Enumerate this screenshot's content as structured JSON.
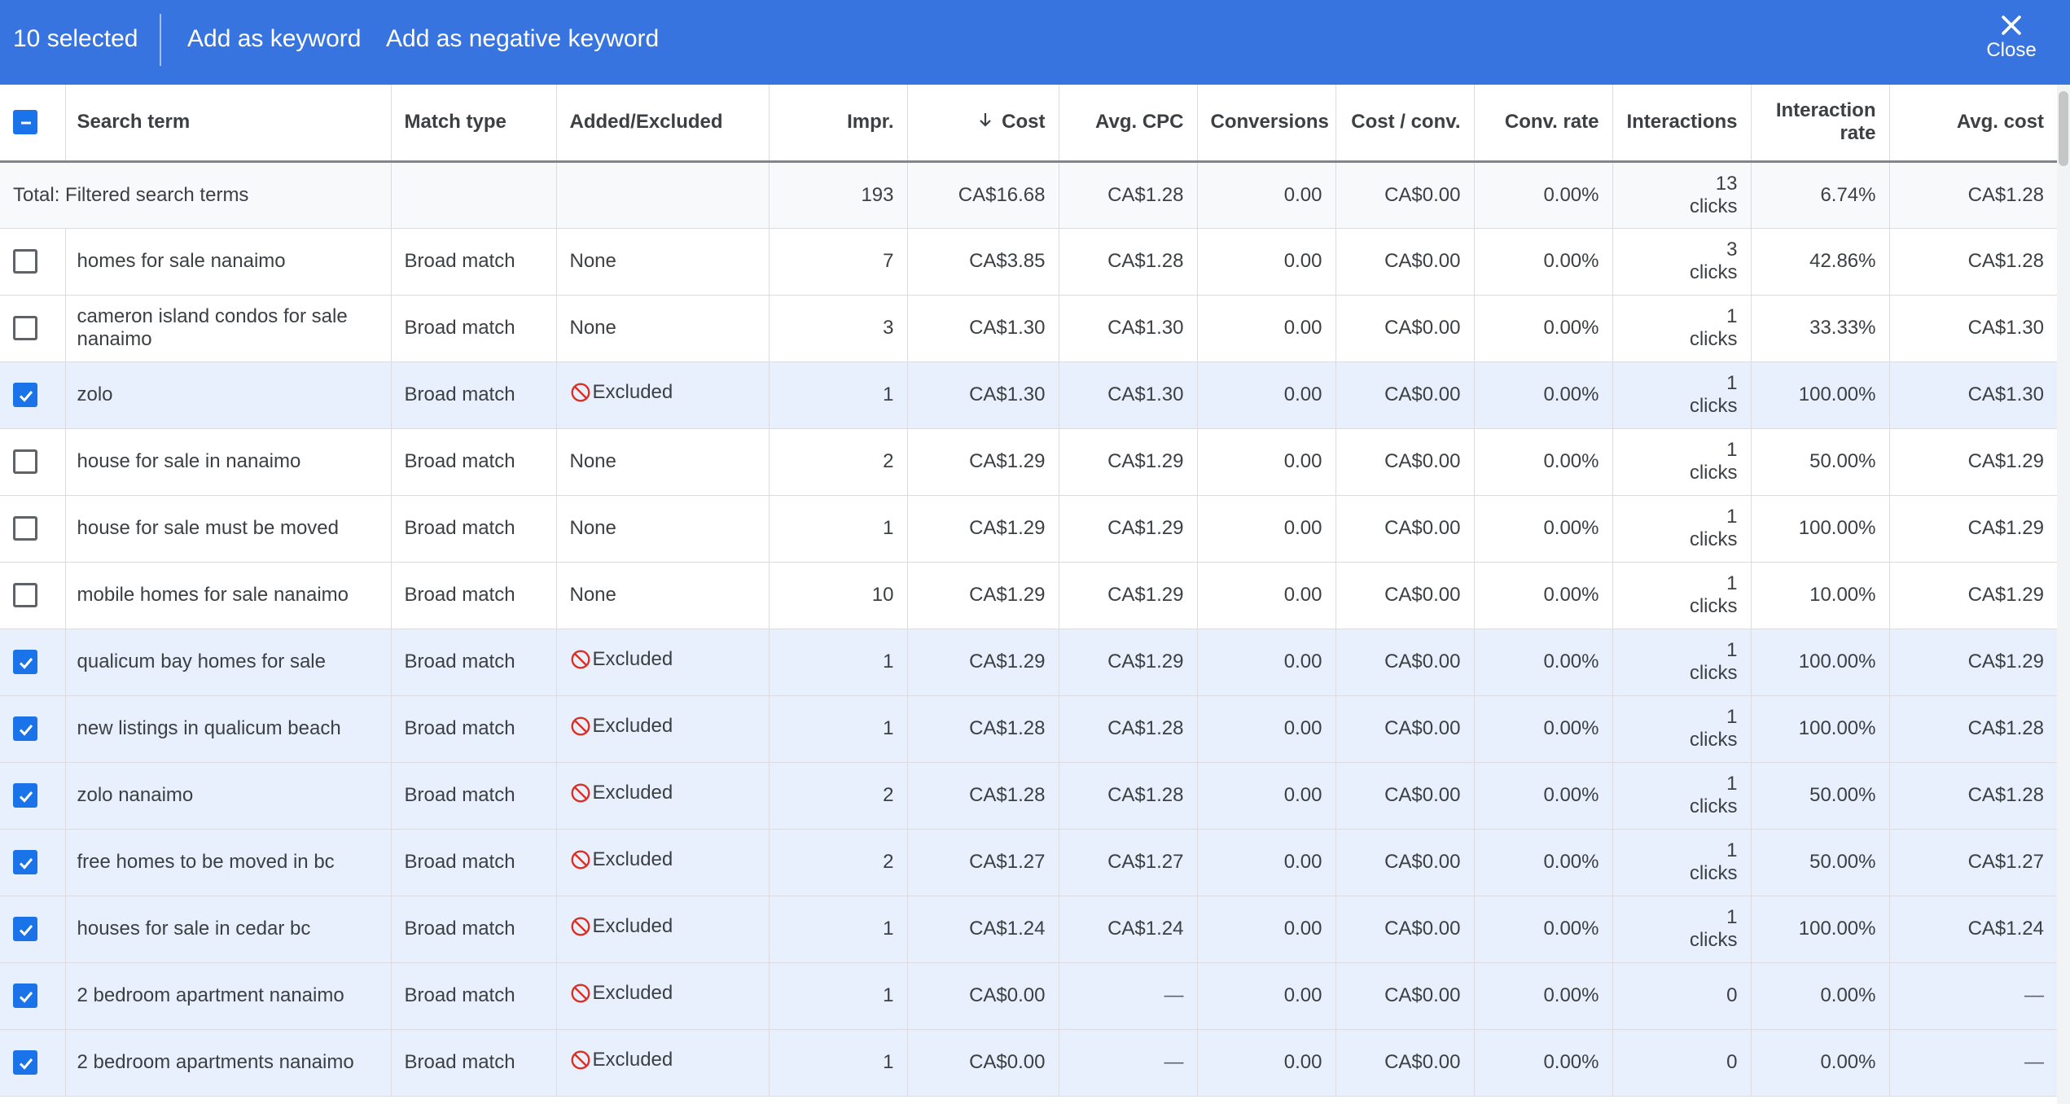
{
  "action_bar": {
    "selected_count": "10 selected",
    "add_keyword": "Add as keyword",
    "add_negative": "Add as negative keyword",
    "close": "Close",
    "color": "#3874e0"
  },
  "columns": {
    "search_term": "Search term",
    "match_type": "Match type",
    "added_excluded": "Added/Excluded",
    "impr": "Impr.",
    "cost": "Cost",
    "avg_cpc": "Avg. CPC",
    "conversions": "Conversions",
    "cost_conv": "Cost / conv.",
    "conv_rate": "Conv. rate",
    "interactions": "Interactions",
    "interaction_rate_1": "Interaction",
    "interaction_rate_2": "rate",
    "avg_cost": "Avg. cost",
    "sorted_by": "Cost",
    "sort_direction": "descending"
  },
  "total": {
    "label": "Total: Filtered search terms",
    "impr": "193",
    "cost": "CA$16.68",
    "avg_cpc": "CA$1.28",
    "conversions": "0.00",
    "cost_conv": "CA$0.00",
    "conv_rate": "0.00%",
    "interactions_n": "13",
    "interactions_unit": "clicks",
    "interaction_rate": "6.74%",
    "avg_cost": "CA$1.28"
  },
  "rows": [
    {
      "checked": false,
      "term": "homes for sale nanaimo",
      "match": "Broad match",
      "status": "None",
      "impr": "7",
      "cost": "CA$3.85",
      "avg_cpc": "CA$1.28",
      "conversions": "0.00",
      "cost_conv": "CA$0.00",
      "conv_rate": "0.00%",
      "interactions_n": "3",
      "interactions_unit": "clicks",
      "interaction_rate": "42.86%",
      "avg_cost": "CA$1.28"
    },
    {
      "checked": false,
      "term": "cameron island condos for sale nanaimo",
      "match": "Broad match",
      "status": "None",
      "impr": "3",
      "cost": "CA$1.30",
      "avg_cpc": "CA$1.30",
      "conversions": "0.00",
      "cost_conv": "CA$0.00",
      "conv_rate": "0.00%",
      "interactions_n": "1",
      "interactions_unit": "clicks",
      "interaction_rate": "33.33%",
      "avg_cost": "CA$1.30"
    },
    {
      "checked": true,
      "term": "zolo",
      "match": "Broad match",
      "status": "Excluded",
      "impr": "1",
      "cost": "CA$1.30",
      "avg_cpc": "CA$1.30",
      "conversions": "0.00",
      "cost_conv": "CA$0.00",
      "conv_rate": "0.00%",
      "interactions_n": "1",
      "interactions_unit": "clicks",
      "interaction_rate": "100.00%",
      "avg_cost": "CA$1.30"
    },
    {
      "checked": false,
      "term": "house for sale in nanaimo",
      "match": "Broad match",
      "status": "None",
      "impr": "2",
      "cost": "CA$1.29",
      "avg_cpc": "CA$1.29",
      "conversions": "0.00",
      "cost_conv": "CA$0.00",
      "conv_rate": "0.00%",
      "interactions_n": "1",
      "interactions_unit": "clicks",
      "interaction_rate": "50.00%",
      "avg_cost": "CA$1.29"
    },
    {
      "checked": false,
      "term": "house for sale must be moved",
      "match": "Broad match",
      "status": "None",
      "impr": "1",
      "cost": "CA$1.29",
      "avg_cpc": "CA$1.29",
      "conversions": "0.00",
      "cost_conv": "CA$0.00",
      "conv_rate": "0.00%",
      "interactions_n": "1",
      "interactions_unit": "clicks",
      "interaction_rate": "100.00%",
      "avg_cost": "CA$1.29"
    },
    {
      "checked": false,
      "term": "mobile homes for sale nanaimo",
      "match": "Broad match",
      "status": "None",
      "impr": "10",
      "cost": "CA$1.29",
      "avg_cpc": "CA$1.29",
      "conversions": "0.00",
      "cost_conv": "CA$0.00",
      "conv_rate": "0.00%",
      "interactions_n": "1",
      "interactions_unit": "clicks",
      "interaction_rate": "10.00%",
      "avg_cost": "CA$1.29"
    },
    {
      "checked": true,
      "term": "qualicum bay homes for sale",
      "match": "Broad match",
      "status": "Excluded",
      "impr": "1",
      "cost": "CA$1.29",
      "avg_cpc": "CA$1.29",
      "conversions": "0.00",
      "cost_conv": "CA$0.00",
      "conv_rate": "0.00%",
      "interactions_n": "1",
      "interactions_unit": "clicks",
      "interaction_rate": "100.00%",
      "avg_cost": "CA$1.29"
    },
    {
      "checked": true,
      "term": "new listings in qualicum beach",
      "match": "Broad match",
      "status": "Excluded",
      "impr": "1",
      "cost": "CA$1.28",
      "avg_cpc": "CA$1.28",
      "conversions": "0.00",
      "cost_conv": "CA$0.00",
      "conv_rate": "0.00%",
      "interactions_n": "1",
      "interactions_unit": "clicks",
      "interaction_rate": "100.00%",
      "avg_cost": "CA$1.28"
    },
    {
      "checked": true,
      "term": "zolo nanaimo",
      "match": "Broad match",
      "status": "Excluded",
      "impr": "2",
      "cost": "CA$1.28",
      "avg_cpc": "CA$1.28",
      "conversions": "0.00",
      "cost_conv": "CA$0.00",
      "conv_rate": "0.00%",
      "interactions_n": "1",
      "interactions_unit": "clicks",
      "interaction_rate": "50.00%",
      "avg_cost": "CA$1.28"
    },
    {
      "checked": true,
      "term": "free homes to be moved in bc",
      "match": "Broad match",
      "status": "Excluded",
      "impr": "2",
      "cost": "CA$1.27",
      "avg_cpc": "CA$1.27",
      "conversions": "0.00",
      "cost_conv": "CA$0.00",
      "conv_rate": "0.00%",
      "interactions_n": "1",
      "interactions_unit": "clicks",
      "interaction_rate": "50.00%",
      "avg_cost": "CA$1.27"
    },
    {
      "checked": true,
      "term": "houses for sale in cedar bc",
      "match": "Broad match",
      "status": "Excluded",
      "impr": "1",
      "cost": "CA$1.24",
      "avg_cpc": "CA$1.24",
      "conversions": "0.00",
      "cost_conv": "CA$0.00",
      "conv_rate": "0.00%",
      "interactions_n": "1",
      "interactions_unit": "clicks",
      "interaction_rate": "100.00%",
      "avg_cost": "CA$1.24"
    },
    {
      "checked": true,
      "term": "2 bedroom apartment nanaimo",
      "match": "Broad match",
      "status": "Excluded",
      "impr": "1",
      "cost": "CA$0.00",
      "avg_cpc": "—",
      "conversions": "0.00",
      "cost_conv": "CA$0.00",
      "conv_rate": "0.00%",
      "interactions_n": "0",
      "interactions_unit": "",
      "interaction_rate": "0.00%",
      "avg_cost": "—"
    },
    {
      "checked": true,
      "term": "2 bedroom apartments nanaimo",
      "match": "Broad match",
      "status": "Excluded",
      "impr": "1",
      "cost": "CA$0.00",
      "avg_cpc": "—",
      "conversions": "0.00",
      "cost_conv": "CA$0.00",
      "conv_rate": "0.00%",
      "interactions_n": "0",
      "interactions_unit": "",
      "interaction_rate": "0.00%",
      "avg_cost": "—"
    }
  ],
  "colors": {
    "selected_row": "#e8f0fe",
    "checkbox_on": "#1a73e8",
    "excluded_icon": "#d93025"
  }
}
